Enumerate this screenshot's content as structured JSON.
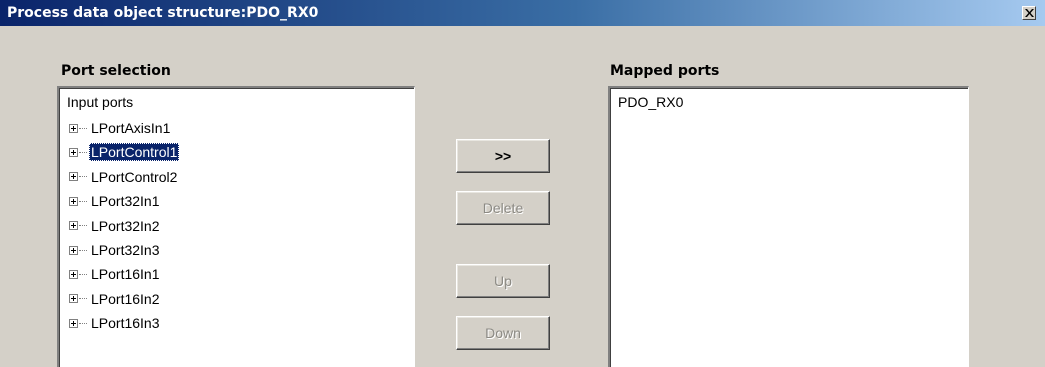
{
  "window": {
    "title": "Process data object structure:PDO_RX0"
  },
  "port_selection": {
    "label": "Port selection",
    "root": "Input ports",
    "items": [
      {
        "label": "LPortAxisIn1",
        "selected": false
      },
      {
        "label": "LPortControl1",
        "selected": true
      },
      {
        "label": "LPortControl2",
        "selected": false
      },
      {
        "label": "LPort32In1",
        "selected": false
      },
      {
        "label": "LPort32In2",
        "selected": false
      },
      {
        "label": "LPort32In3",
        "selected": false
      },
      {
        "label": "LPort16In1",
        "selected": false
      },
      {
        "label": "LPort16In2",
        "selected": false
      },
      {
        "label": "LPort16In3",
        "selected": false
      }
    ]
  },
  "buttons": {
    "add": {
      "label": ">>",
      "enabled": true
    },
    "delete": {
      "label": "Delete",
      "enabled": false
    },
    "up": {
      "label": "Up",
      "enabled": false
    },
    "down": {
      "label": "Down",
      "enabled": false
    }
  },
  "mapped_ports": {
    "label": "Mapped ports",
    "items": [
      "PDO_RX0"
    ]
  },
  "icons": {
    "close": "close-icon",
    "expander": "plus-box-icon"
  },
  "colors": {
    "title_bar_start": "#0a246a",
    "title_bar_end": "#a6caf0",
    "selection": "#0a246a",
    "dialog_bg": "#d4d0c8"
  }
}
